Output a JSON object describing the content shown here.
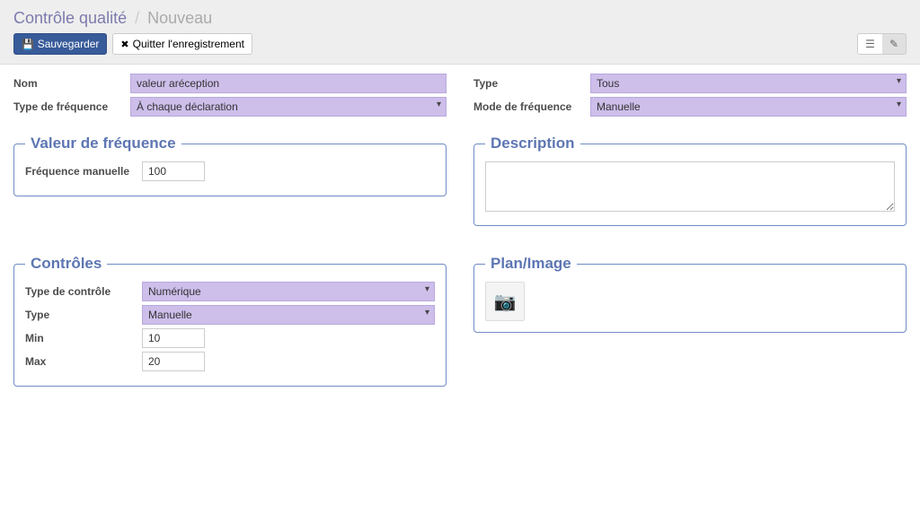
{
  "breadcrumb": {
    "root": "Contrôle qualité",
    "current": "Nouveau",
    "sep": "/"
  },
  "buttons": {
    "save": "Sauvegarder",
    "discard": "Quitter l'enregistrement"
  },
  "fields": {
    "nom_label": "Nom",
    "nom_value": "valeur aréception",
    "type_label": "Type",
    "type_value": "Tous",
    "freq_type_label": "Type de fréquence",
    "freq_type_value": "À chaque déclaration",
    "freq_mode_label": "Mode de fréquence",
    "freq_mode_value": "Manuelle"
  },
  "frequency_group": {
    "legend": "Valeur de fréquence",
    "manual_freq_label": "Fréquence manuelle",
    "manual_freq_value": "100"
  },
  "description_group": {
    "legend": "Description",
    "value": ""
  },
  "controls_group": {
    "legend": "Contrôles",
    "control_type_label": "Type de contrôle",
    "control_type_value": "Numérique",
    "type_label": "Type",
    "type_value": "Manuelle",
    "min_label": "Min",
    "min_value": "10",
    "max_label": "Max",
    "max_value": "20"
  },
  "plan_group": {
    "legend": "Plan/Image"
  }
}
